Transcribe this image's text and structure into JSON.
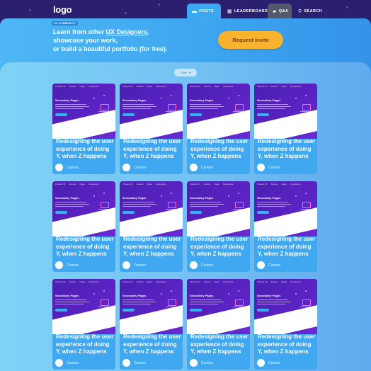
{
  "header": {
    "logo": "logo",
    "nav": [
      {
        "label": "POSTS",
        "icon": "posts-icon"
      },
      {
        "label": "LEADERBOARD",
        "icon": "grid-icon"
      },
      {
        "label": "Q&A",
        "icon": "chat-icon"
      },
      {
        "label": "SEARCH",
        "icon": "search-icon"
      }
    ]
  },
  "hero": {
    "badge": "UX COMMUNITY",
    "line1_prefix": "Learn from other ",
    "line1_highlight": "UX Designers",
    "line1_suffix": ",",
    "line2": "showcase your work,",
    "line3": "or build a beautiful portfolio (for free).",
    "invite_label": "Request invite"
  },
  "filter": {
    "label": "New"
  },
  "thumbnail": {
    "brand": "Prospect UX",
    "nav": [
      "Services",
      "Pages",
      "Components"
    ],
    "page_title": "Secondary Pages"
  },
  "cards": [
    {
      "title": "Redesigning the user experience of doing Y, when Z happens",
      "author": "Camino"
    },
    {
      "title": "Redesigning the user experience of doing Y, when Z happens",
      "author": "Camino"
    },
    {
      "title": "Redesigning the user experience of doing Y, when Z happens",
      "author": "Camino"
    },
    {
      "title": "Redesigning the user experience of doing Y, when Z happens",
      "author": "Camino"
    },
    {
      "title": "Redesigning the user experience of doing Y, when Z happens",
      "author": "Camino"
    },
    {
      "title": "Redesigning the user experience of doing Y, when Z happens",
      "author": "Camino"
    },
    {
      "title": "Redesigning the user experience of doing Y, when Z happens",
      "author": "Camino"
    },
    {
      "title": "Redesigning the user experience of doing Y, when Z happens",
      "author": "Camino"
    },
    {
      "title": "Redesigning the user experience of doing Y, when Z happens",
      "author": "Camino"
    },
    {
      "title": "Redesigning the user experience of doing Y, when Z happens",
      "author": "Camino"
    },
    {
      "title": "Redesigning the user experience of doing Y, when Z happens",
      "author": "Camino"
    },
    {
      "title": "Redesigning the user experience of doing Y, when Z happens",
      "author": "Camino"
    }
  ],
  "colors": {
    "topbar": "#2b1f6f",
    "posts_tab": "#3aa9f1",
    "invite_button": "#f7b32e",
    "thumbnail_purple": "#5b23c4",
    "card_body": "#3fa8f1"
  }
}
